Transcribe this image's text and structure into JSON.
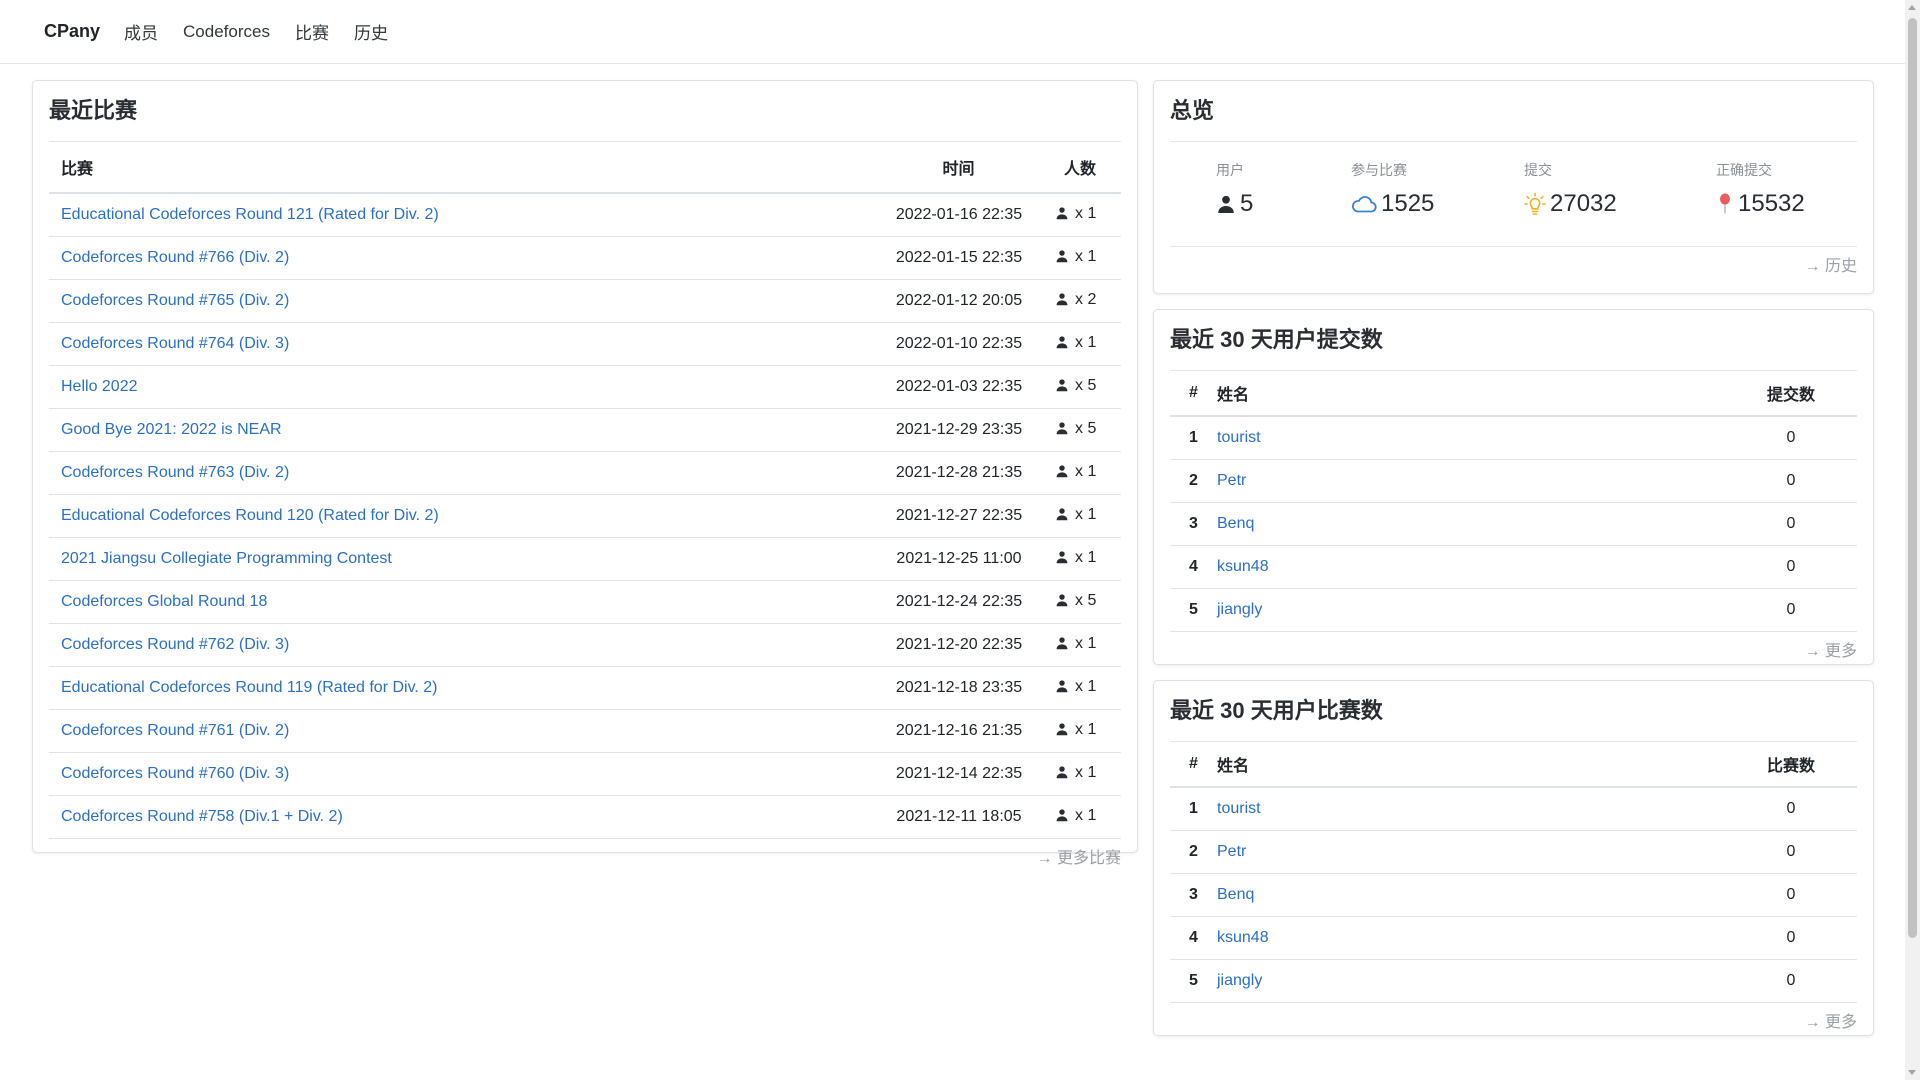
{
  "nav": {
    "brand": "CPany",
    "items": [
      "成员",
      "Codeforces",
      "比赛",
      "历史"
    ]
  },
  "recent_contests": {
    "title": "最近比赛",
    "headers": {
      "name": "比赛",
      "time": "时间",
      "count": "人数"
    },
    "rows": [
      {
        "name": "Educational Codeforces Round 121 (Rated for Div. 2)",
        "time": "2022-01-16 22:35",
        "count": "x 1"
      },
      {
        "name": "Codeforces Round #766 (Div. 2)",
        "time": "2022-01-15 22:35",
        "count": "x 1"
      },
      {
        "name": "Codeforces Round #765 (Div. 2)",
        "time": "2022-01-12 20:05",
        "count": "x 2"
      },
      {
        "name": "Codeforces Round #764 (Div. 3)",
        "time": "2022-01-10 22:35",
        "count": "x 1"
      },
      {
        "name": "Hello 2022",
        "time": "2022-01-03 22:35",
        "count": "x 5"
      },
      {
        "name": "Good Bye 2021: 2022 is NEAR",
        "time": "2021-12-29 23:35",
        "count": "x 5"
      },
      {
        "name": "Codeforces Round #763 (Div. 2)",
        "time": "2021-12-28 21:35",
        "count": "x 1"
      },
      {
        "name": "Educational Codeforces Round 120 (Rated for Div. 2)",
        "time": "2021-12-27 22:35",
        "count": "x 1"
      },
      {
        "name": "2021 Jiangsu Collegiate Programming Contest",
        "time": "2021-12-25 11:00",
        "count": "x 1"
      },
      {
        "name": "Codeforces Global Round 18",
        "time": "2021-12-24 22:35",
        "count": "x 5"
      },
      {
        "name": "Codeforces Round #762 (Div. 3)",
        "time": "2021-12-20 22:35",
        "count": "x 1"
      },
      {
        "name": "Educational Codeforces Round 119 (Rated for Div. 2)",
        "time": "2021-12-18 23:35",
        "count": "x 1"
      },
      {
        "name": "Codeforces Round #761 (Div. 2)",
        "time": "2021-12-16 21:35",
        "count": "x 1"
      },
      {
        "name": "Codeforces Round #760 (Div. 3)",
        "time": "2021-12-14 22:35",
        "count": "x 1"
      },
      {
        "name": "Codeforces Round #758 (Div.1 + Div. 2)",
        "time": "2021-12-11 18:05",
        "count": "x 1"
      }
    ],
    "more": "→ 更多比赛"
  },
  "overview": {
    "title": "总览",
    "stats": [
      {
        "label": "用户",
        "value": "5",
        "icon": "person-icon"
      },
      {
        "label": "参与比赛",
        "value": "1525",
        "icon": "cloud-icon"
      },
      {
        "label": "提交",
        "value": "27032",
        "icon": "lightbulb-icon"
      },
      {
        "label": "正确提交",
        "value": "15532",
        "icon": "pin-icon"
      }
    ],
    "more": "→ 历史"
  },
  "submissions_30d": {
    "title": "最近 30 天用户提交数",
    "headers": {
      "idx": "#",
      "name": "姓名",
      "value": "提交数"
    },
    "rows": [
      {
        "idx": "1",
        "name": "tourist",
        "value": "0"
      },
      {
        "idx": "2",
        "name": "Petr",
        "value": "0"
      },
      {
        "idx": "3",
        "name": "Benq",
        "value": "0"
      },
      {
        "idx": "4",
        "name": "ksun48",
        "value": "0"
      },
      {
        "idx": "5",
        "name": "jiangly",
        "value": "0"
      }
    ],
    "more": "→ 更多"
  },
  "contests_30d": {
    "title": "最近 30 天用户比赛数",
    "headers": {
      "idx": "#",
      "name": "姓名",
      "value": "比赛数"
    },
    "rows": [
      {
        "idx": "1",
        "name": "tourist",
        "value": "0"
      },
      {
        "idx": "2",
        "name": "Petr",
        "value": "0"
      },
      {
        "idx": "3",
        "name": "Benq",
        "value": "0"
      },
      {
        "idx": "4",
        "name": "ksun48",
        "value": "0"
      },
      {
        "idx": "5",
        "name": "jiangly",
        "value": "0"
      }
    ],
    "more": "→ 更多"
  },
  "colors": {
    "link": "#2a6fc9",
    "muted": "#9aa0a6",
    "cloud": "#3b82d6",
    "bulb": "#f2b01e",
    "pin": "#e85d5d"
  }
}
